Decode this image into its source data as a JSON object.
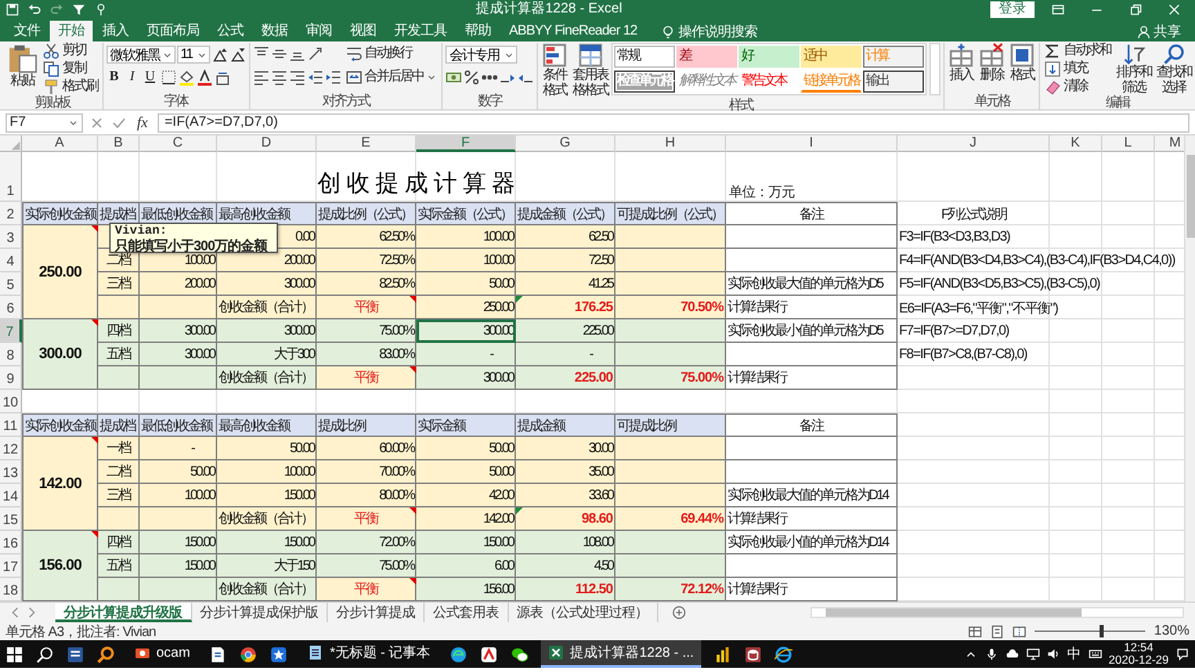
{
  "window": {
    "title": "提成计算器1228 - Excel",
    "sign_in": "登录"
  },
  "menu_tabs": [
    {
      "label": "文件",
      "selected": false
    },
    {
      "label": "开始",
      "selected": true
    },
    {
      "label": "插入",
      "selected": false
    },
    {
      "label": "页面布局",
      "selected": false
    },
    {
      "label": "公式",
      "selected": false
    },
    {
      "label": "数据",
      "selected": false
    },
    {
      "label": "审阅",
      "selected": false
    },
    {
      "label": "视图",
      "selected": false
    },
    {
      "label": "开发工具",
      "selected": false
    },
    {
      "label": "帮助",
      "selected": false
    },
    {
      "label": "ABBYY FineReader 12",
      "selected": false
    }
  ],
  "tell_me": "操作说明搜索",
  "share": "共享",
  "ribbon": {
    "clipboard": {
      "name": "剪贴板",
      "buttons": [
        "粘贴",
        "剪切",
        "复制",
        "格式刷"
      ]
    },
    "font": {
      "name": "字体",
      "font": "微软雅黑",
      "size": "11",
      "toggles": [
        "B",
        "I",
        "U"
      ]
    },
    "alignment": {
      "name": "对齐方式",
      "buttons": [
        "自动换行",
        "合并后居中"
      ]
    },
    "number": {
      "name": "数字",
      "format": "会计专用"
    },
    "styles": {
      "name": "样式",
      "buttons": [
        "条件格式",
        "套用表格格式"
      ],
      "gallery": [
        {
          "label": "常规",
          "kind": "normal"
        },
        {
          "label": "差",
          "kind": "bad"
        },
        {
          "label": "好",
          "kind": "good"
        },
        {
          "label": "适中",
          "kind": "neutral"
        },
        {
          "label": "计算",
          "kind": "calculation"
        },
        {
          "label": "检查单元格",
          "kind": "check"
        },
        {
          "label": "解释性文本",
          "kind": "explanatory"
        },
        {
          "label": "警告文本",
          "kind": "warning"
        },
        {
          "label": "链接单元格",
          "kind": "linked"
        },
        {
          "label": "输出",
          "kind": "output"
        }
      ]
    },
    "cells": {
      "name": "单元格",
      "buttons": [
        "插入",
        "删除",
        "格式"
      ]
    },
    "editing": {
      "name": "编辑",
      "buttons": [
        "自动求和",
        "填充",
        "清除",
        "排序和筛选",
        "查找和选择"
      ]
    }
  },
  "formula_bar": {
    "name_box": "F7",
    "function_label": "fx",
    "formula": "=IF(A7>=D7,D7,0)"
  },
  "sheet": {
    "title": "创收提成计算器",
    "unit": "单位：万元",
    "columns": [
      {
        "label": "A",
        "selected": false
      },
      {
        "label": "B",
        "selected": false
      },
      {
        "label": "C",
        "selected": false
      },
      {
        "label": "D",
        "selected": false
      },
      {
        "label": "E",
        "selected": false
      },
      {
        "label": "F",
        "selected": true
      },
      {
        "label": "G",
        "selected": false
      },
      {
        "label": "H",
        "selected": false
      },
      {
        "label": "I",
        "selected": false
      },
      {
        "label": "J",
        "selected": false
      },
      {
        "label": "K",
        "selected": false
      },
      {
        "label": "L",
        "selected": false
      },
      {
        "label": "M",
        "selected": false
      }
    ],
    "rows": [
      {
        "label": "1",
        "selected": false
      },
      {
        "label": "2",
        "selected": false,
        "cells": [
          {
            "text": "实际创收金额",
            "kind": "heading",
            "color": "#d9e1f2"
          },
          {
            "text": "提成档",
            "kind": "heading",
            "color": "#d9e1f2"
          },
          {
            "text": "最低创收金额",
            "kind": "heading",
            "color": "#d9e1f2"
          },
          {
            "text": "最高创收金额",
            "kind": "heading",
            "color": "#d9e1f2"
          },
          {
            "text": "提成比例（公式）",
            "kind": "heading",
            "color": "#d9e1f2"
          },
          {
            "text": "实际金额（公式）",
            "kind": "heading",
            "color": "#d9e1f2"
          },
          {
            "text": "提成金额（公式）",
            "kind": "heading",
            "color": "#d9e1f2"
          },
          {
            "text": "可提成比例（公式）",
            "kind": "heading",
            "color": "#d9e1f2"
          },
          {
            "text": "备注",
            "kind": "center",
            "color": "#ffffff"
          },
          {
            "text": "F列公式说明",
            "kind": "center"
          }
        ]
      },
      {
        "label": "3",
        "selected": false,
        "cells": [
          {
            "text": "250.00",
            "kind": "amount",
            "color": "#fff2cc",
            "comment": true
          },
          {
            "color": "#fff2cc"
          },
          {
            "kind": "covered"
          },
          {
            "text": "0.00",
            "kind": "number",
            "color": "#fff2cc"
          },
          {
            "text": "62.50%",
            "kind": "number",
            "color": "#fff2cc"
          },
          {
            "text": "100.00",
            "kind": "number",
            "color": "#fff2cc"
          },
          {
            "text": "62.50",
            "kind": "number",
            "color": "#fff2cc"
          },
          {
            "color": "#fff2cc"
          },
          {
            "color": "#ffffff"
          },
          {
            "text": "F3=IF(B3<D3,B3,D3)",
            "kind": "formula"
          }
        ]
      },
      {
        "label": "4",
        "selected": false,
        "cells": [
          {
            "kind": "merged"
          },
          {
            "text": "二档",
            "kind": "center",
            "color": "#fff2cc"
          },
          {
            "text": "100.00",
            "kind": "number",
            "color": "#fff2cc"
          },
          {
            "text": "200.00",
            "kind": "number",
            "color": "#fff2cc"
          },
          {
            "text": "72.50%",
            "kind": "number",
            "color": "#fff2cc"
          },
          {
            "text": "100.00",
            "kind": "number",
            "color": "#fff2cc"
          },
          {
            "text": "72.50",
            "kind": "number",
            "color": "#fff2cc"
          },
          {
            "color": "#fff2cc"
          },
          {
            "color": "#ffffff"
          },
          {
            "text": "F4=IF(AND(B3<D4,B3>C4),(B3-C4),IF(B3>D4,C4,0))",
            "kind": "formula"
          }
        ]
      },
      {
        "label": "5",
        "selected": false,
        "cells": [
          {
            "kind": "merged"
          },
          {
            "text": "三档",
            "kind": "center",
            "color": "#fff2cc"
          },
          {
            "text": "200.00",
            "kind": "number",
            "color": "#fff2cc"
          },
          {
            "text": "300.00",
            "kind": "number",
            "color": "#fff2cc"
          },
          {
            "text": "82.50%",
            "kind": "number",
            "color": "#fff2cc"
          },
          {
            "text": "50.00",
            "kind": "number",
            "color": "#fff2cc"
          },
          {
            "text": "41.25",
            "kind": "number",
            "color": "#fff2cc"
          },
          {
            "color": "#fff2cc"
          },
          {
            "text": "实际创收最大值的单元格为D5",
            "kind": "text",
            "color": "#ffffff"
          },
          {
            "text": "F5=IF(AND(B3<D5,B3>C5),(B3-C5),0)",
            "kind": "formula"
          }
        ]
      },
      {
        "label": "6",
        "selected": false,
        "cells": [
          {
            "kind": "merged"
          },
          {
            "color": "#fff2cc"
          },
          {
            "color": "#fff2cc"
          },
          {
            "text": "创收金额（合计）",
            "kind": "text",
            "color": "#fff2cc"
          },
          {
            "text": "平衡",
            "kind": "status",
            "color": "#fff2cc",
            "comment": true
          },
          {
            "text": "250.00",
            "kind": "number",
            "color": "#fff2cc"
          },
          {
            "text": "176.25",
            "kind": "total",
            "color": "#fff2cc",
            "error": true
          },
          {
            "text": "70.50%",
            "kind": "total",
            "color": "#fff2cc"
          },
          {
            "text": "计算结果行",
            "kind": "text",
            "color": "#ffffff"
          },
          {
            "text": "E6=IF(A3=F6,\"平衡\",\"不平衡\")",
            "kind": "formula"
          }
        ]
      },
      {
        "label": "7",
        "selected": true,
        "cells": [
          {
            "text": "300.00",
            "kind": "amount",
            "color": "#e2efda",
            "comment": true
          },
          {
            "text": "四档",
            "kind": "center",
            "color": "#e2efda"
          },
          {
            "text": "300.00",
            "kind": "number",
            "color": "#e2efda"
          },
          {
            "text": "300.00",
            "kind": "number",
            "color": "#e2efda"
          },
          {
            "text": "75.00%",
            "kind": "number",
            "color": "#e2efda"
          },
          {
            "text": "300.00",
            "kind": "number",
            "color": "#e2efda"
          },
          {
            "text": "225.00",
            "kind": "number",
            "color": "#e2efda"
          },
          {
            "color": "#e2efda"
          },
          {
            "text": "实际创收最小值的单元格为D5",
            "kind": "text",
            "color": "#ffffff"
          },
          {
            "text": "F7=IF(B7>=D7,D7,0)",
            "kind": "formula"
          }
        ]
      },
      {
        "label": "8",
        "selected": false,
        "cells": [
          {
            "kind": "merged"
          },
          {
            "text": "五档",
            "kind": "center",
            "color": "#e2efda"
          },
          {
            "text": "300.00",
            "kind": "number",
            "color": "#e2efda"
          },
          {
            "text": "大于300",
            "kind": "number",
            "color": "#e2efda"
          },
          {
            "text": "83.00%",
            "kind": "number",
            "color": "#e2efda"
          },
          {
            "text": "-",
            "kind": "dash",
            "color": "#e2efda"
          },
          {
            "text": "-",
            "kind": "dash",
            "color": "#e2efda"
          },
          {
            "color": "#e2efda"
          },
          {
            "color": "#ffffff"
          },
          {
            "text": "F8=IF(B7>C8,(B7-C8),0)",
            "kind": "formula"
          }
        ]
      },
      {
        "label": "9",
        "selected": false,
        "cells": [
          {
            "kind": "merged"
          },
          {
            "color": "#e2efda"
          },
          {
            "color": "#e2efda"
          },
          {
            "text": "创收金额（合计）",
            "kind": "text",
            "color": "#e2efda"
          },
          {
            "text": "平衡",
            "kind": "status",
            "color": "#fff2cc",
            "comment": true
          },
          {
            "text": "300.00",
            "kind": "number",
            "color": "#e2efda"
          },
          {
            "text": "225.00",
            "kind": "total",
            "color": "#e2efda"
          },
          {
            "text": "75.00%",
            "kind": "total",
            "color": "#e2efda"
          },
          {
            "text": "计算结果行",
            "kind": "text",
            "color": "#ffffff"
          }
        ]
      },
      {
        "label": "10",
        "selected": false
      },
      {
        "label": "11",
        "selected": false,
        "cells": [
          {
            "text": "实际创收金额",
            "kind": "heading",
            "color": "#d9e1f2"
          },
          {
            "text": "提成档",
            "kind": "heading",
            "color": "#d9e1f2"
          },
          {
            "text": "最低创收金额",
            "kind": "heading",
            "color": "#d9e1f2"
          },
          {
            "text": "最高创收金额",
            "kind": "heading",
            "color": "#d9e1f2"
          },
          {
            "text": "提成比例",
            "kind": "heading",
            "color": "#d9e1f2"
          },
          {
            "text": "实际金额",
            "kind": "heading",
            "color": "#d9e1f2"
          },
          {
            "text": "提成金额",
            "kind": "heading",
            "color": "#d9e1f2"
          },
          {
            "text": "可提成比例",
            "kind": "heading",
            "color": "#d9e1f2"
          },
          {
            "text": "备注",
            "kind": "center",
            "color": "#ffffff"
          }
        ]
      },
      {
        "label": "12",
        "selected": false,
        "cells": [
          {
            "text": "142.00",
            "kind": "amount",
            "color": "#fff2cc",
            "comment": true
          },
          {
            "text": "一档",
            "kind": "center",
            "color": "#fff2cc"
          },
          {
            "text": "-",
            "kind": "dash",
            "color": "#fff2cc"
          },
          {
            "text": "50.00",
            "kind": "number",
            "color": "#fff2cc"
          },
          {
            "text": "60.00%",
            "kind": "number",
            "color": "#fff2cc"
          },
          {
            "text": "50.00",
            "kind": "number",
            "color": "#fff2cc"
          },
          {
            "text": "30.00",
            "kind": "number",
            "color": "#fff2cc"
          },
          {
            "color": "#fff2cc"
          },
          {
            "color": "#ffffff"
          }
        ]
      },
      {
        "label": "13",
        "selected": false,
        "cells": [
          {
            "kind": "merged"
          },
          {
            "text": "二档",
            "kind": "center",
            "color": "#fff2cc"
          },
          {
            "text": "50.00",
            "kind": "number",
            "color": "#fff2cc"
          },
          {
            "text": "100.00",
            "kind": "number",
            "color": "#fff2cc"
          },
          {
            "text": "70.00%",
            "kind": "number",
            "color": "#fff2cc"
          },
          {
            "text": "50.00",
            "kind": "number",
            "color": "#fff2cc"
          },
          {
            "text": "35.00",
            "kind": "number",
            "color": "#fff2cc"
          },
          {
            "color": "#fff2cc"
          },
          {
            "color": "#ffffff"
          }
        ]
      },
      {
        "label": "14",
        "selected": false,
        "cells": [
          {
            "kind": "merged"
          },
          {
            "text": "三档",
            "kind": "center",
            "color": "#fff2cc"
          },
          {
            "text": "100.00",
            "kind": "number",
            "color": "#fff2cc"
          },
          {
            "text": "150.00",
            "kind": "number",
            "color": "#fff2cc"
          },
          {
            "text": "80.00%",
            "kind": "number",
            "color": "#fff2cc"
          },
          {
            "text": "42.00",
            "kind": "number",
            "color": "#fff2cc"
          },
          {
            "text": "33.60",
            "kind": "number",
            "color": "#fff2cc"
          },
          {
            "color": "#fff2cc"
          },
          {
            "text": "实际创收最大值的单元格为D14",
            "kind": "text",
            "color": "#ffffff"
          }
        ]
      },
      {
        "label": "15",
        "selected": false,
        "cells": [
          {
            "kind": "merged"
          },
          {
            "color": "#fff2cc"
          },
          {
            "color": "#fff2cc"
          },
          {
            "text": "创收金额（合计）",
            "kind": "text",
            "color": "#fff2cc"
          },
          {
            "text": "平衡",
            "kind": "status",
            "color": "#fff2cc",
            "comment": true
          },
          {
            "text": "142.00",
            "kind": "number",
            "color": "#fff2cc"
          },
          {
            "text": "98.60",
            "kind": "total",
            "color": "#fff2cc",
            "error": true
          },
          {
            "text": "69.44%",
            "kind": "total",
            "color": "#fff2cc"
          },
          {
            "text": "计算结果行",
            "kind": "text",
            "color": "#ffffff"
          }
        ]
      },
      {
        "label": "16",
        "selected": false,
        "cells": [
          {
            "text": "156.00",
            "kind": "amount",
            "color": "#e2efda",
            "comment": true
          },
          {
            "text": "四档",
            "kind": "center",
            "color": "#e2efda"
          },
          {
            "text": "150.00",
            "kind": "number",
            "color": "#e2efda"
          },
          {
            "text": "150.00",
            "kind": "number",
            "color": "#e2efda"
          },
          {
            "text": "72.00%",
            "kind": "number",
            "color": "#e2efda"
          },
          {
            "text": "150.00",
            "kind": "number",
            "color": "#e2efda"
          },
          {
            "text": "108.00",
            "kind": "number",
            "color": "#e2efda"
          },
          {
            "color": "#e2efda"
          },
          {
            "text": "实际创收最小值的单元格为D14",
            "kind": "text",
            "color": "#ffffff"
          }
        ]
      },
      {
        "label": "17",
        "selected": false,
        "cells": [
          {
            "kind": "merged"
          },
          {
            "text": "五档",
            "kind": "center",
            "color": "#e2efda"
          },
          {
            "text": "150.00",
            "kind": "number",
            "color": "#e2efda"
          },
          {
            "text": "大于150",
            "kind": "number",
            "color": "#e2efda"
          },
          {
            "text": "75.00%",
            "kind": "number",
            "color": "#e2efda"
          },
          {
            "text": "6.00",
            "kind": "number",
            "color": "#e2efda"
          },
          {
            "text": "4.50",
            "kind": "number",
            "color": "#e2efda"
          },
          {
            "color": "#e2efda"
          },
          {
            "color": "#ffffff"
          }
        ]
      },
      {
        "label": "18",
        "selected": false,
        "cells": [
          {
            "kind": "merged"
          },
          {
            "color": "#e2efda"
          },
          {
            "color": "#e2efda"
          },
          {
            "text": "创收金额（合计）",
            "kind": "text",
            "color": "#e2efda"
          },
          {
            "text": "平衡",
            "kind": "status",
            "color": "#fff2cc",
            "comment": true
          },
          {
            "text": "156.00",
            "kind": "number",
            "color": "#e2efda"
          },
          {
            "text": "112.50",
            "kind": "total",
            "color": "#e2efda"
          },
          {
            "text": "72.12%",
            "kind": "total",
            "color": "#e2efda"
          },
          {
            "text": "计算结果行",
            "kind": "text",
            "color": "#ffffff"
          }
        ]
      }
    ],
    "comment": {
      "author": "Vivian:",
      "text": "只能填写小于300万的金额"
    }
  },
  "sheet_tabs": [
    {
      "label": "分步计算提成升级版",
      "selected": true
    },
    {
      "label": "分步计算提成保护版",
      "selected": false
    },
    {
      "label": "分步计算提成",
      "selected": false
    },
    {
      "label": "公式套用表",
      "selected": false
    },
    {
      "label": "源表（公式处理过程）",
      "selected": false
    }
  ],
  "status_bar": {
    "text": "单元格 A3，批注者: Vivian",
    "zoom": "130%",
    "zoom_slider": {
      "level": 0.6
    }
  },
  "taskbar": {
    "apps": [
      {
        "label": "ocam",
        "selected": false
      },
      {
        "label": "*无标题 - 记事本",
        "selected": false
      },
      {
        "label": "提成计算器1228 - ...",
        "selected": true
      }
    ],
    "ime": "中",
    "time": "12:54",
    "date": "2020-12-29"
  }
}
